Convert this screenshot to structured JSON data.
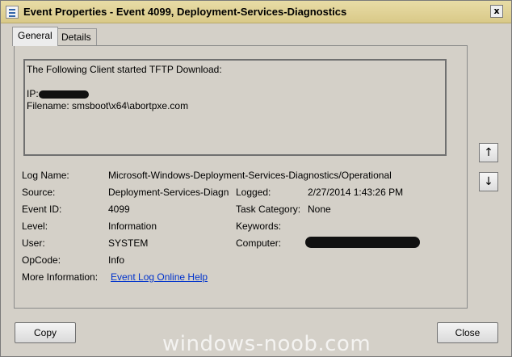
{
  "window": {
    "title": "Event Properties - Event 4099, Deployment-Services-Diagnostics",
    "close_glyph": "x"
  },
  "tabs": [
    {
      "label": "General",
      "active": true
    },
    {
      "label": "Details",
      "active": false
    }
  ],
  "description": {
    "line1": "The Following Client started TFTP Download:",
    "ip_label": "IP:",
    "filename_line": "Filename: smsboot\\x64\\abortpxe.com"
  },
  "fields": {
    "log_name_label": "Log Name:",
    "log_name_value": "Microsoft-Windows-Deployment-Services-Diagnostics/Operational",
    "source_label": "Source:",
    "source_value": "Deployment-Services-Diagn",
    "logged_label": "Logged:",
    "logged_value": "2/27/2014 1:43:26 PM",
    "event_id_label": "Event ID:",
    "event_id_value": "4099",
    "task_category_label": "Task Category:",
    "task_category_value": "None",
    "level_label": "Level:",
    "level_value": "Information",
    "keywords_label": "Keywords:",
    "user_label": "User:",
    "user_value": "SYSTEM",
    "computer_label": "Computer:",
    "opcode_label": "OpCode:",
    "opcode_value": "Info",
    "more_info_label": "More Information:",
    "more_info_link": "Event Log Online Help"
  },
  "side_buttons": {
    "up_glyph": "↑",
    "down_glyph": "↓"
  },
  "buttons": {
    "copy": "Copy",
    "close": "Close"
  },
  "watermark": "windows-noob.com",
  "colors": {
    "dialog_bg": "#d4d0c8",
    "title_bar": "#dccd8f",
    "link": "#0033cc"
  }
}
